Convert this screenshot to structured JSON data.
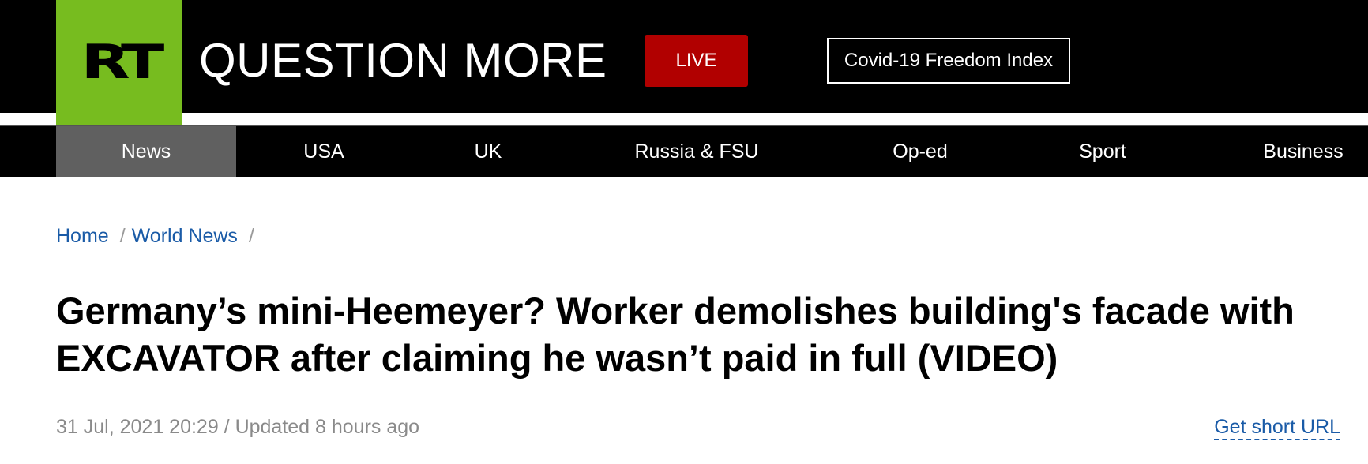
{
  "header": {
    "logo": "RT",
    "tagline": "QUESTION MORE",
    "live_label": "LIVE",
    "covid_label": "Covid-19 Freedom Index"
  },
  "nav": {
    "items": [
      {
        "label": "News",
        "active": true
      },
      {
        "label": "USA"
      },
      {
        "label": "UK"
      },
      {
        "label": "Russia & FSU"
      },
      {
        "label": "Op-ed"
      },
      {
        "label": "Sport"
      },
      {
        "label": "Business"
      }
    ]
  },
  "breadcrumb": {
    "items": [
      "Home",
      "World News"
    ],
    "separator": "/"
  },
  "article": {
    "title": "Germany’s mini-Heemeyer? Worker demolishes building's facade with EXCAVATOR after claiming he wasn’t paid in full (VIDEO)",
    "meta": "31 Jul, 2021 20:29 / Updated 8 hours ago",
    "short_url_label": "Get short URL"
  },
  "colors": {
    "brand_green": "#77bc1f",
    "live_red": "#b10000",
    "link_blue": "#1a5ba7",
    "nav_active": "#606060"
  }
}
